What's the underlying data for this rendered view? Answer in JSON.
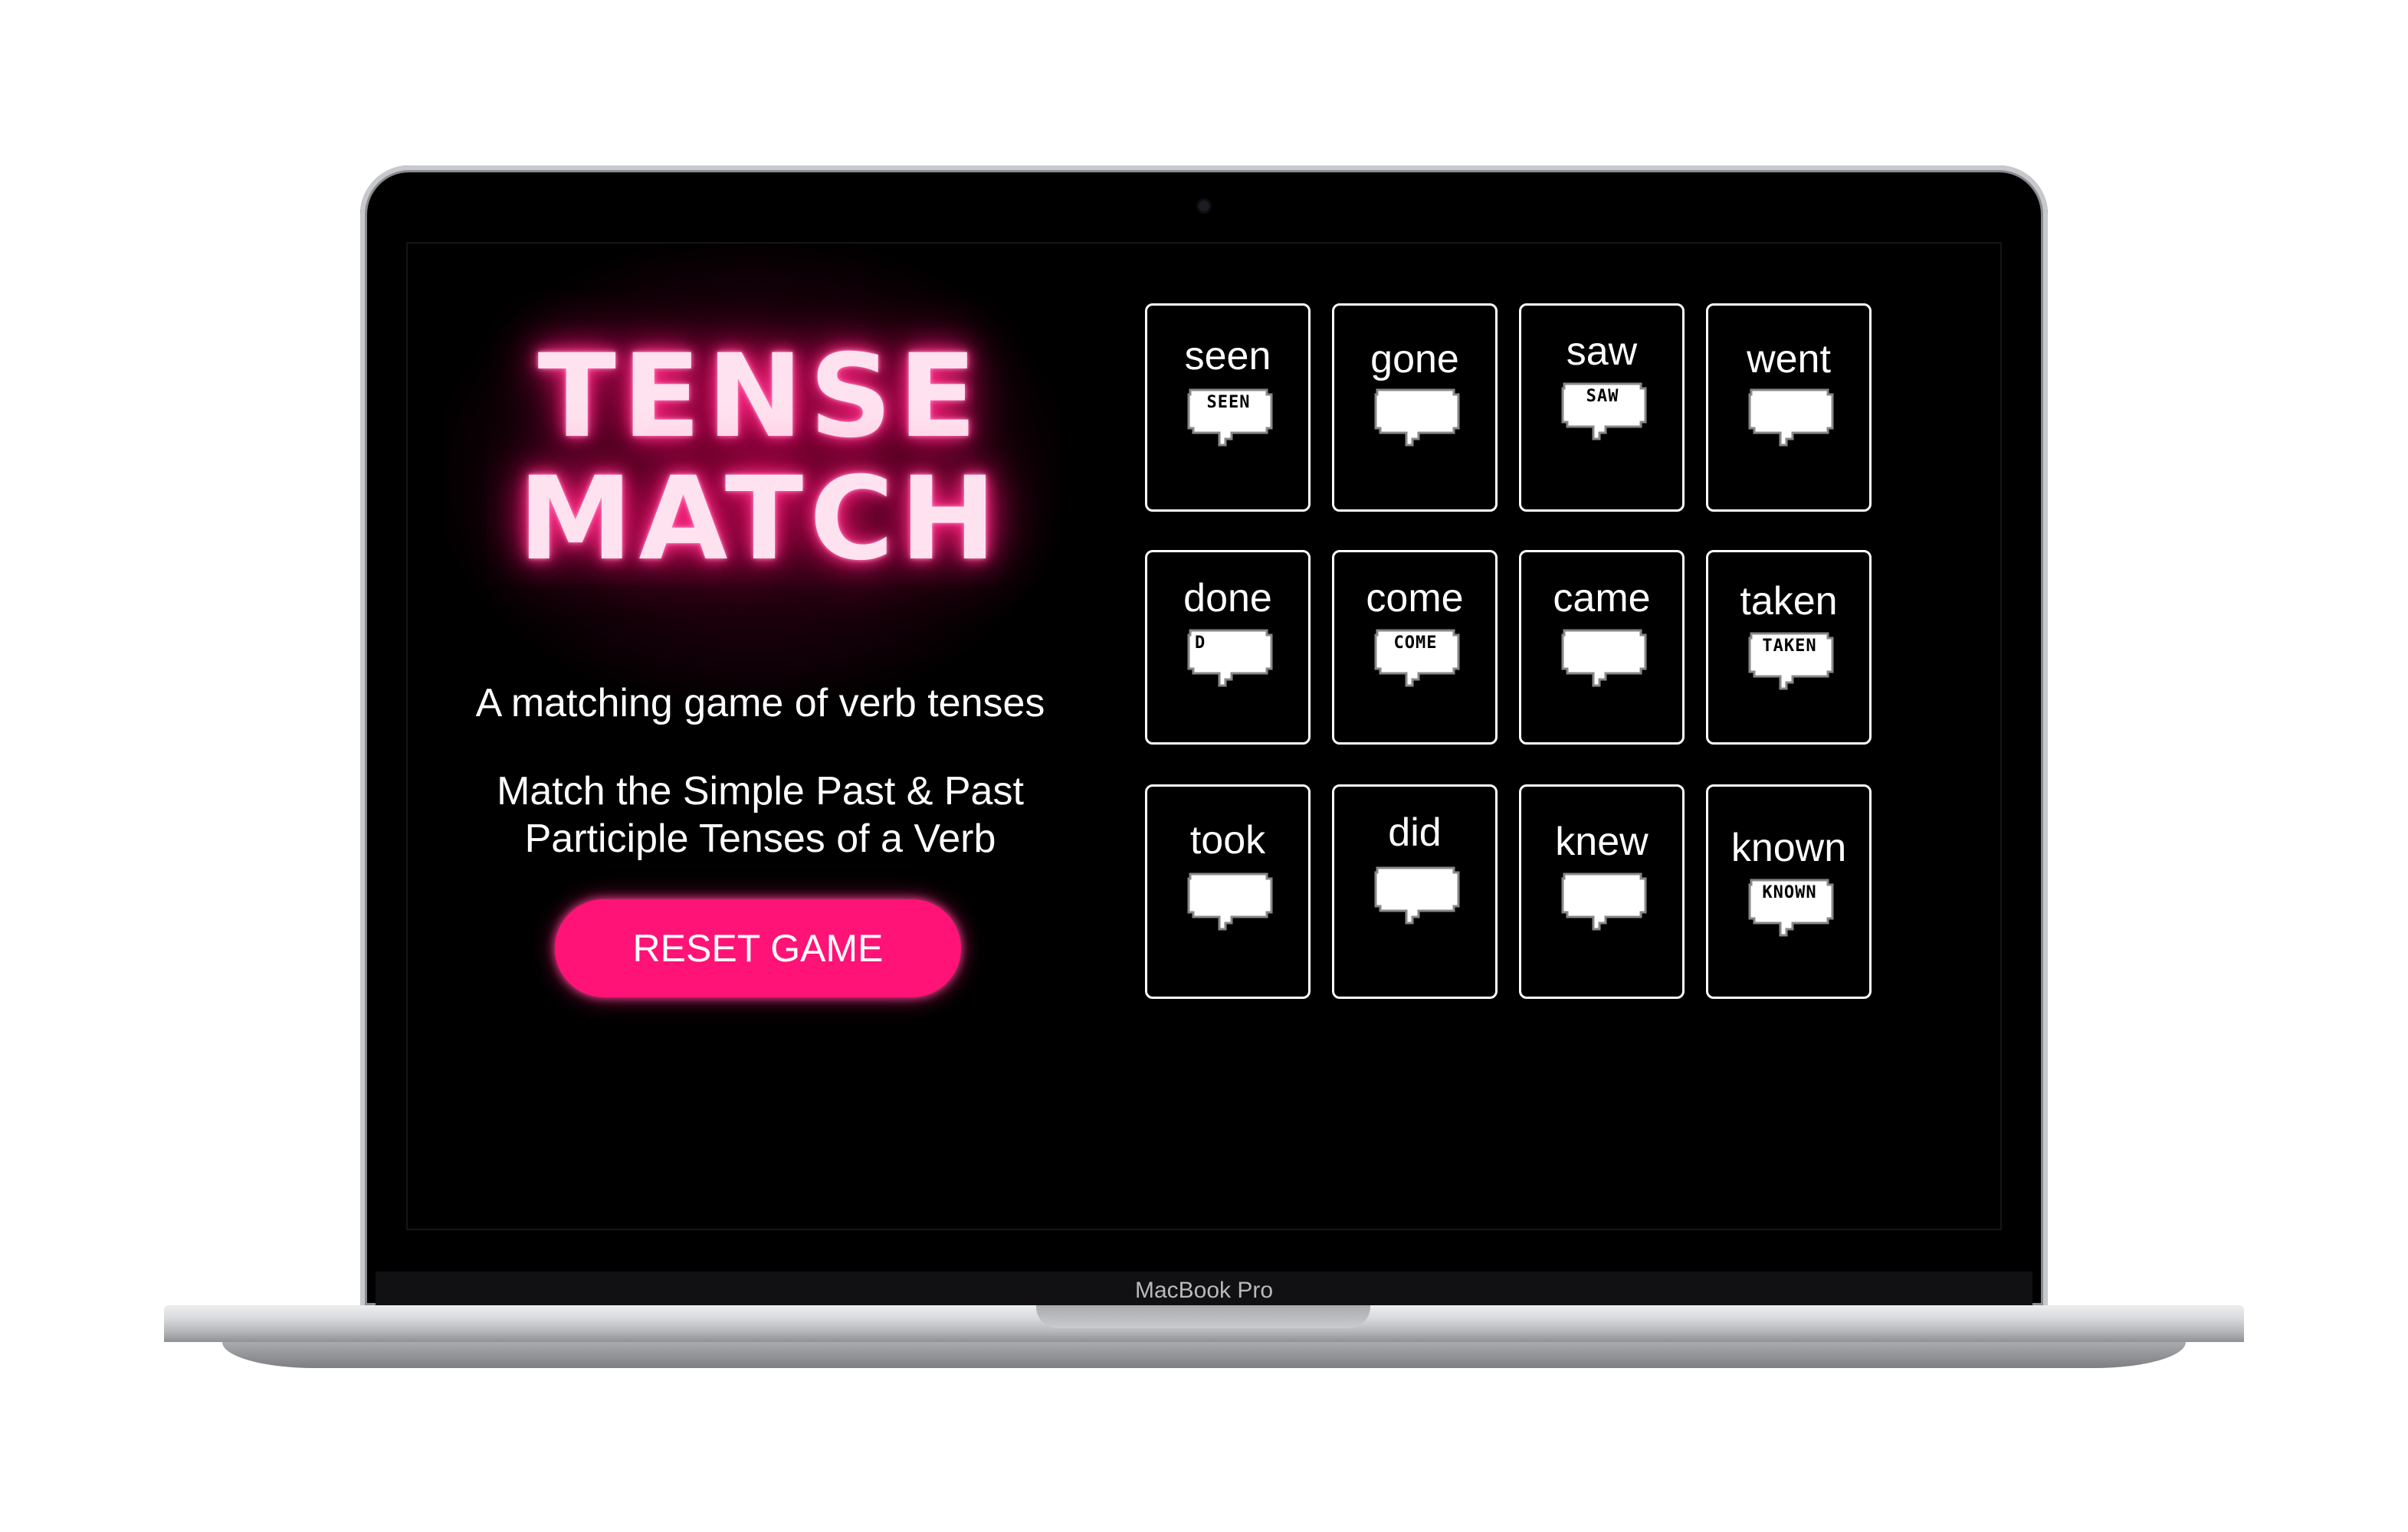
{
  "device": {
    "model_label": "MacBook Pro"
  },
  "app": {
    "title_line1": "TENSE",
    "title_line2": "MATCH",
    "subtitle": "A matching game of verb tenses",
    "instructions_line1": "Match the Simple Past & Past",
    "instructions_line2": "Participle Tenses of a Verb",
    "reset_label": "RESET GAME"
  },
  "cards": [
    {
      "word": "seen",
      "bubble": "SEEN"
    },
    {
      "word": "gone",
      "bubble": ""
    },
    {
      "word": "saw",
      "bubble": "SAW"
    },
    {
      "word": "went",
      "bubble": ""
    },
    {
      "word": "done",
      "bubble": "D"
    },
    {
      "word": "come",
      "bubble": "COME"
    },
    {
      "word": "came",
      "bubble": ""
    },
    {
      "word": "taken",
      "bubble": "TAKEN"
    },
    {
      "word": "took",
      "bubble": ""
    },
    {
      "word": "did",
      "bubble": ""
    },
    {
      "word": "knew",
      "bubble": ""
    },
    {
      "word": "known",
      "bubble": "KNOWN"
    }
  ],
  "colors": {
    "accent": "#ff1376",
    "glow": "#ff3d92",
    "background": "#000000",
    "card_border": "#ffffff"
  },
  "icons": {
    "card_icon": "speech-bubble-icon"
  }
}
